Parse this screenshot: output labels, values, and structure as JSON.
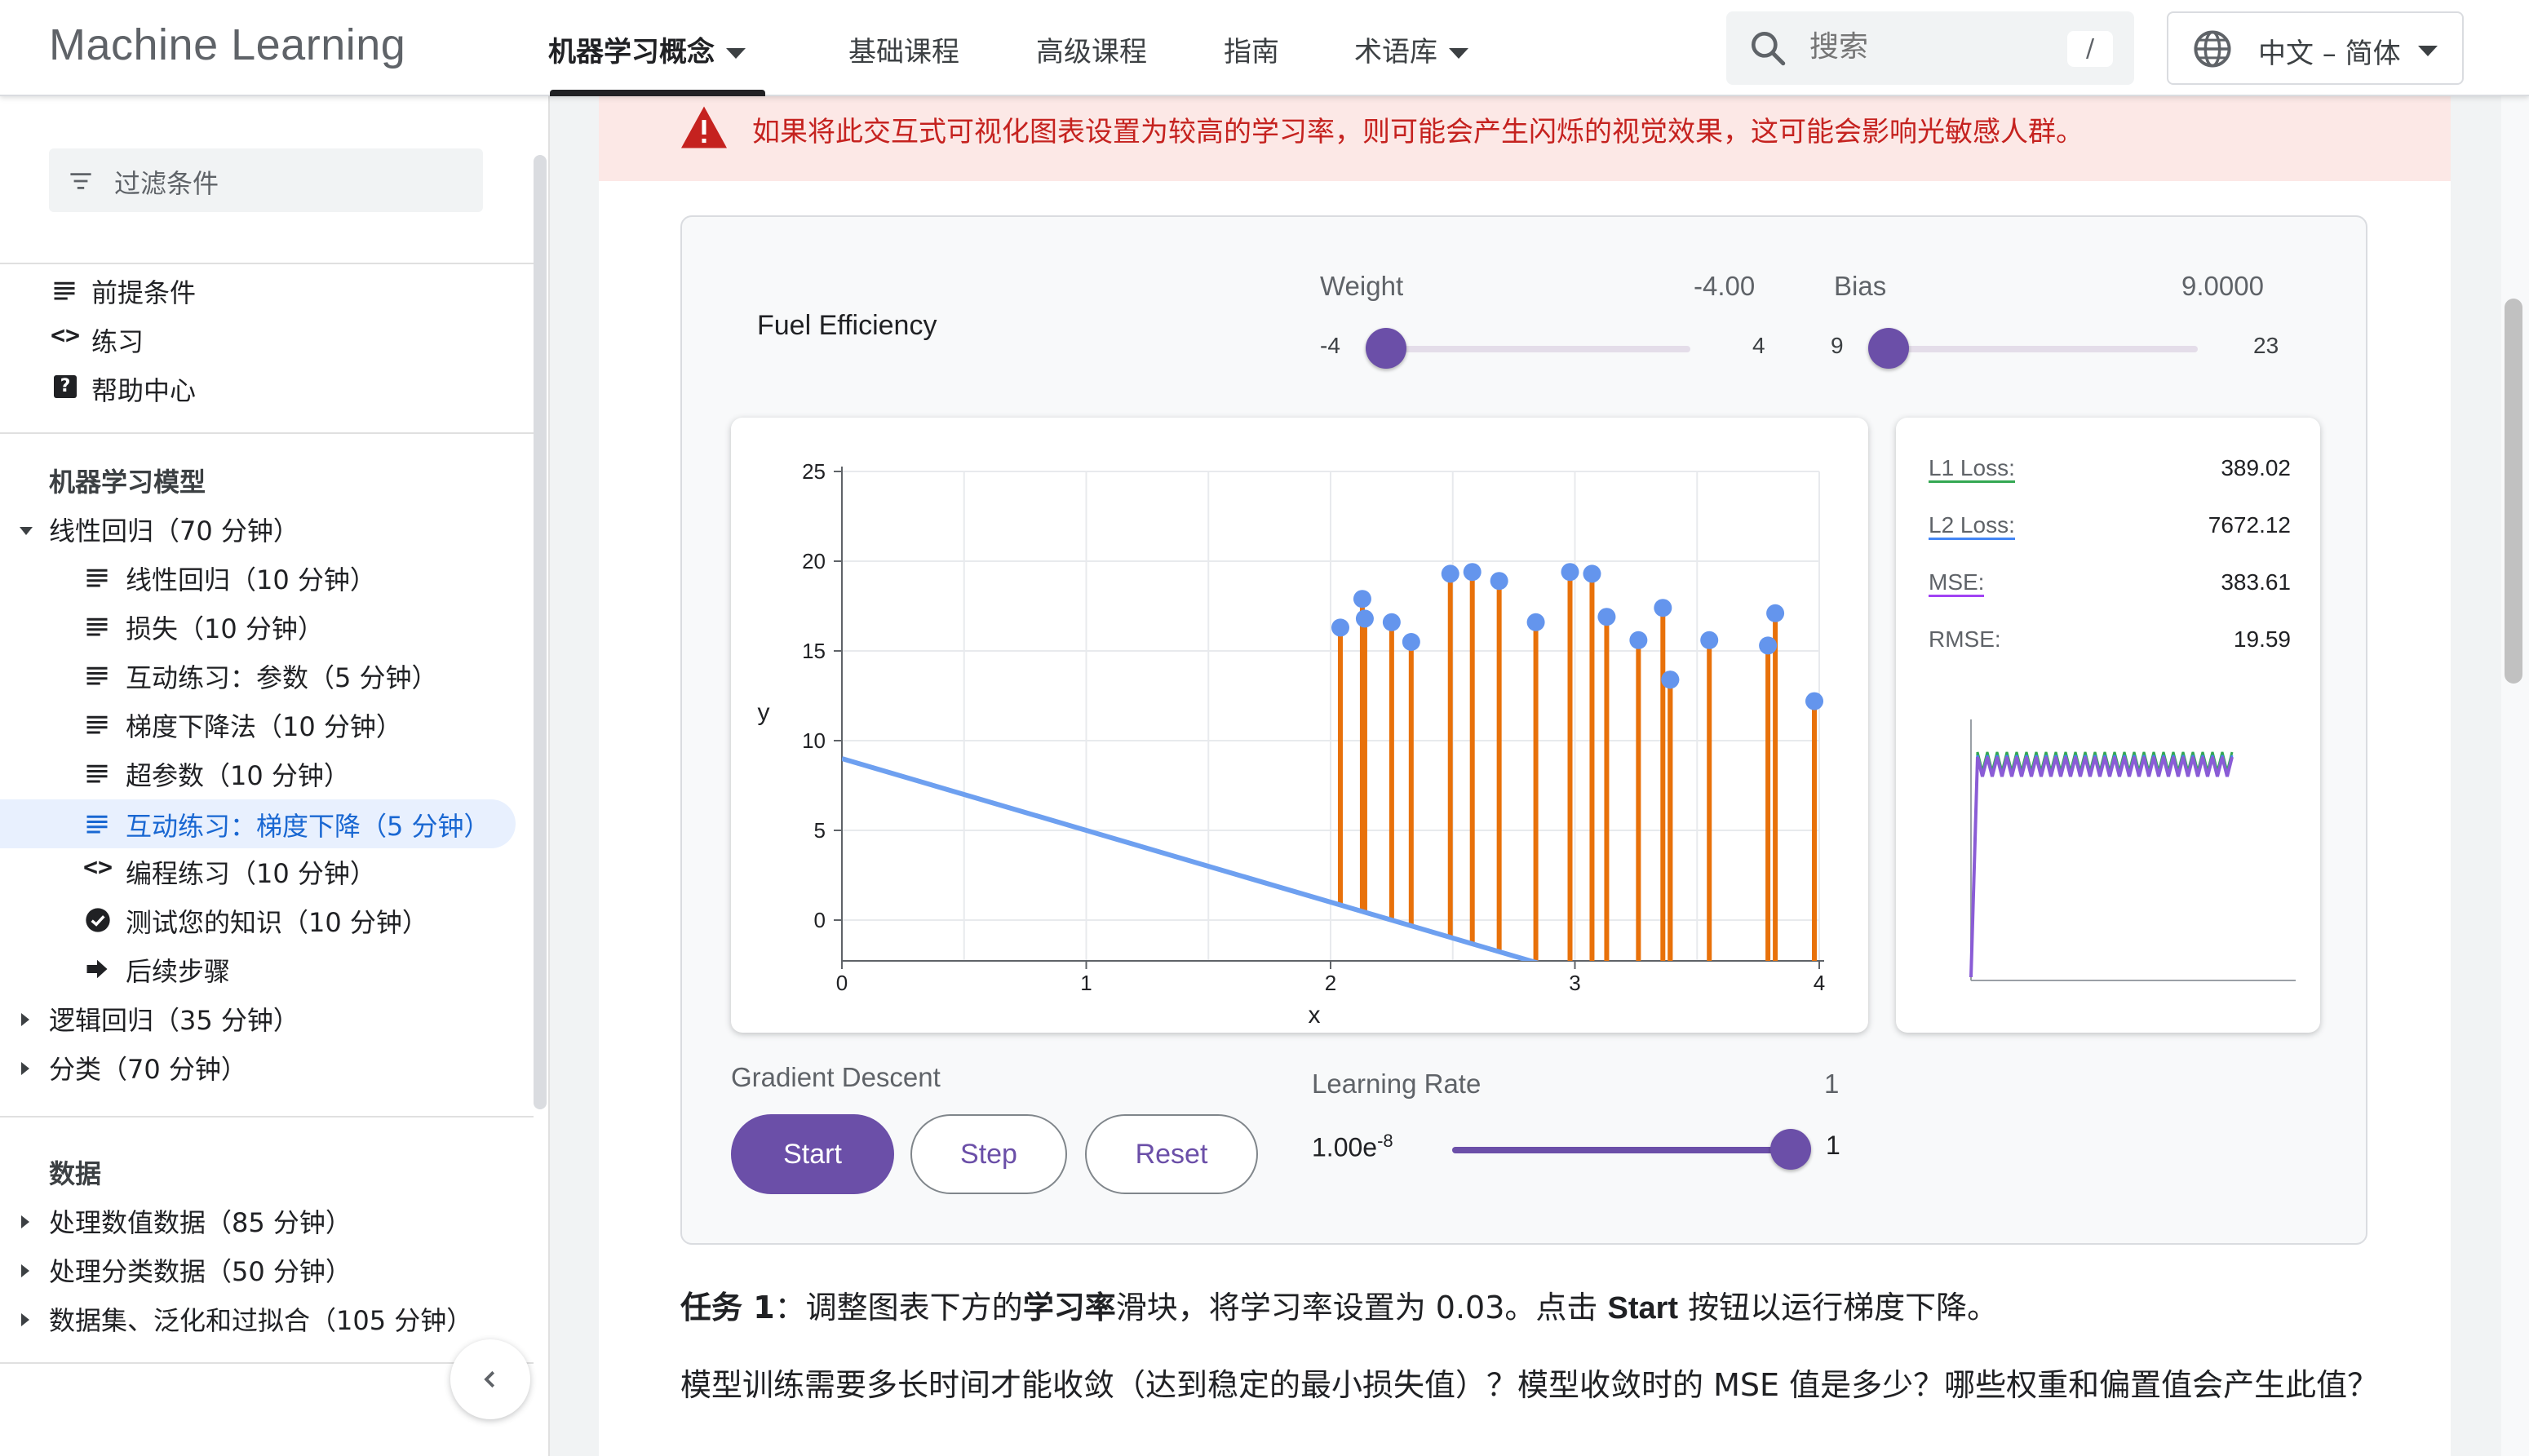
{
  "header": {
    "brand": "Machine Learning",
    "nav": [
      {
        "label": "机器学习概念",
        "dropdown": true,
        "active": true
      },
      {
        "label": "基础课程"
      },
      {
        "label": "高级课程"
      },
      {
        "label": "指南"
      },
      {
        "label": "术语库",
        "dropdown": true
      }
    ],
    "search": {
      "placeholder": "搜索",
      "shortcut": "/"
    },
    "language": "中文 – 简体"
  },
  "sidebar": {
    "filter_placeholder": "过滤条件",
    "top_links": [
      {
        "label": "前提条件",
        "icon": "document-lines-icon"
      },
      {
        "label": "练习",
        "icon": "code-icon"
      },
      {
        "label": "帮助中心",
        "icon": "help-icon"
      }
    ],
    "section1": {
      "heading": "机器学习模型",
      "groups": [
        {
          "label": "线性回归（70 分钟）",
          "expanded": true,
          "items": [
            {
              "label": "线性回归（10 分钟）",
              "icon": "document-lines-icon"
            },
            {
              "label": "损失（10 分钟）",
              "icon": "document-lines-icon"
            },
            {
              "label": "互动练习：参数（5 分钟）",
              "icon": "document-lines-icon"
            },
            {
              "label": "梯度下降法（10 分钟）",
              "icon": "document-lines-icon"
            },
            {
              "label": "超参数（10 分钟）",
              "icon": "document-lines-icon"
            },
            {
              "label": "互动练习：梯度下降（5 分钟）",
              "icon": "document-lines-icon",
              "active": true
            },
            {
              "label": "编程练习（10 分钟）",
              "icon": "code-icon"
            },
            {
              "label": "测试您的知识（10 分钟）",
              "icon": "check-circle-icon"
            },
            {
              "label": "后续步骤",
              "icon": "arrow-right-icon"
            }
          ]
        },
        {
          "label": "逻辑回归（35 分钟）",
          "expanded": false
        },
        {
          "label": "分类（70 分钟）",
          "expanded": false
        }
      ]
    },
    "section2": {
      "heading": "数据",
      "groups": [
        {
          "label": "处理数值数据（85 分钟）"
        },
        {
          "label": "处理分类数据（50 分钟）"
        },
        {
          "label": "数据集、泛化和过拟合（105 分钟）"
        }
      ]
    }
  },
  "warning": "如果将此交互式可视化图表设置为较高的学习率，则可能会产生闪烁的视觉效果，这可能会影响光敏感人群。",
  "widget": {
    "dataset_title": "Fuel Efficiency",
    "weight": {
      "label": "Weight",
      "value": "-4.00",
      "min": "-4",
      "max": "4",
      "fraction": 0.0
    },
    "bias": {
      "label": "Bias",
      "value": "9.0000",
      "min": "9",
      "max": "23",
      "fraction": 0.0
    },
    "losses": [
      {
        "label": "L1 Loss:",
        "value": "389.02",
        "color": "#34a853"
      },
      {
        "label": "L2 Loss:",
        "value": "7672.12",
        "color": "#4285f4"
      },
      {
        "label": "MSE:",
        "value": "383.61",
        "color": "#a142f4"
      },
      {
        "label": "RMSE:",
        "value": "19.59",
        "color": ""
      }
    ],
    "gradient_descent": {
      "title": "Gradient Descent",
      "start": "Start",
      "step": "Step",
      "reset": "Reset"
    },
    "learning_rate": {
      "label": "Learning Rate",
      "display_value": "1",
      "min_base": "1.00e",
      "min_exp": "-8",
      "max": "1",
      "fraction": 1.0
    }
  },
  "content": {
    "task_prefix": "任务 1",
    "task_seg1": "：调整图表下方的",
    "task_bold1": "学习率",
    "task_seg2": "滑块，将学习率设置为 0.03。点击 ",
    "task_bold2": "Start",
    "task_seg3": " 按钮以运行梯度下降。",
    "question": "模型训练需要多长时间才能收敛（达到稳定的最小损失值）？模型收敛时的 MSE 值是多少？哪些权重和偏置值会产生此值？"
  },
  "chart_data": {
    "type": "scatter",
    "xlabel": "x",
    "ylabel": "y",
    "xlim": [
      0,
      4
    ],
    "ylim": [
      0,
      25
    ],
    "x_ticks": [
      "0",
      "1",
      "2",
      "3",
      "4"
    ],
    "y_ticks": [
      "0",
      "5",
      "10",
      "15",
      "20",
      "25"
    ],
    "points": [
      {
        "x": 2.04,
        "y": 16.3
      },
      {
        "x": 2.13,
        "y": 17.9
      },
      {
        "x": 2.14,
        "y": 16.8
      },
      {
        "x": 2.25,
        "y": 16.6
      },
      {
        "x": 2.33,
        "y": 15.5
      },
      {
        "x": 2.49,
        "y": 19.3
      },
      {
        "x": 2.58,
        "y": 19.4
      },
      {
        "x": 2.69,
        "y": 18.9
      },
      {
        "x": 2.84,
        "y": 16.6
      },
      {
        "x": 2.98,
        "y": 19.4
      },
      {
        "x": 3.07,
        "y": 19.3
      },
      {
        "x": 3.13,
        "y": 16.9
      },
      {
        "x": 3.26,
        "y": 15.6
      },
      {
        "x": 3.36,
        "y": 17.4
      },
      {
        "x": 3.39,
        "y": 13.4
      },
      {
        "x": 3.39,
        "y": 13.4
      },
      {
        "x": 3.55,
        "y": 15.6
      },
      {
        "x": 3.79,
        "y": 15.3
      },
      {
        "x": 3.82,
        "y": 17.1
      },
      {
        "x": 3.98,
        "y": 12.2
      }
    ],
    "model_line": {
      "weight": -4.0,
      "bias": 9.0
    },
    "residual_color": "#e8710a",
    "point_color": "#6495ed",
    "line_color": "#6ea0f0"
  }
}
